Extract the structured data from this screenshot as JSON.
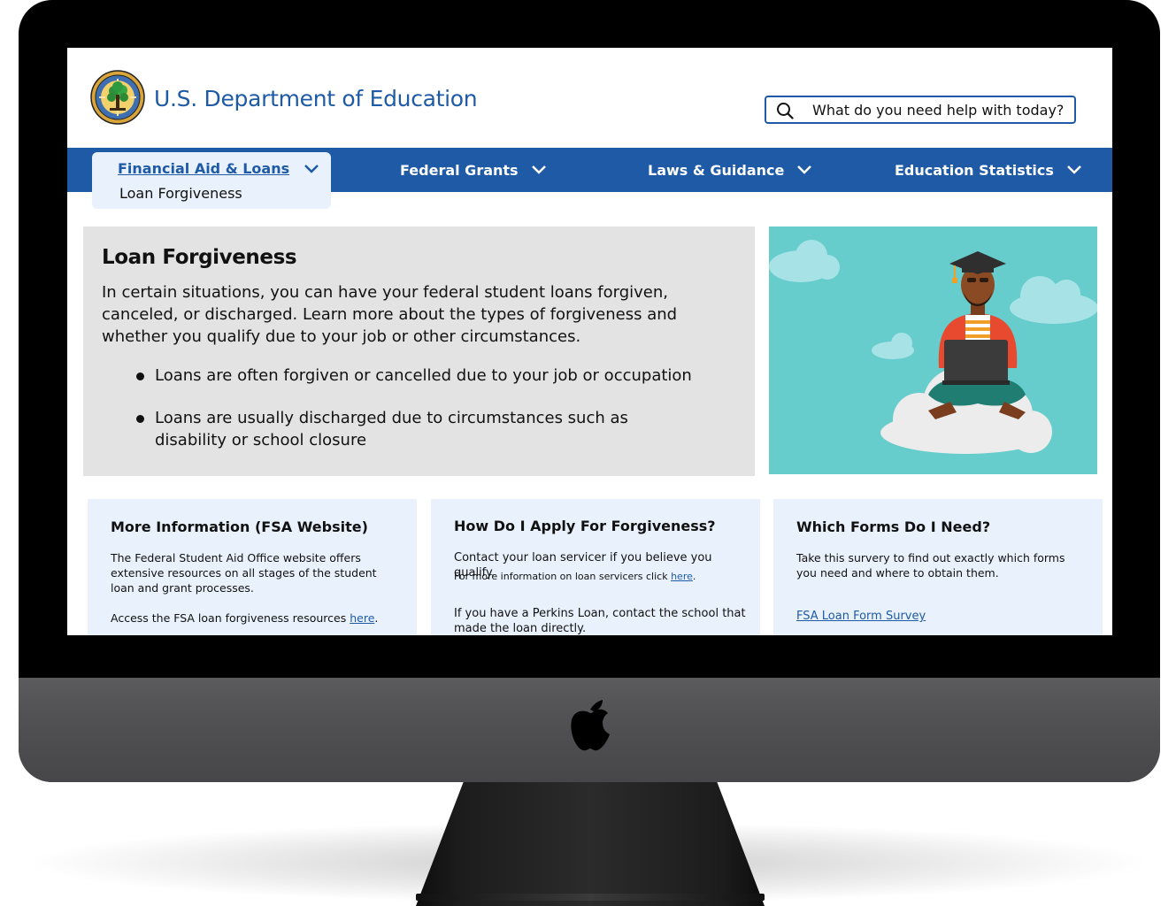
{
  "site": {
    "title": "U.S. Department of Education",
    "brand_color": "#1f5aa6"
  },
  "search": {
    "placeholder": "What do you need help with today?",
    "icon": "search-icon"
  },
  "nav": {
    "items": [
      {
        "label": "Financial Aid & Loans",
        "active": true
      },
      {
        "label": "Federal Grants"
      },
      {
        "label": "Laws & Guidance"
      },
      {
        "label": "Education Statistics"
      }
    ],
    "submenu": {
      "label": "Loan Forgiveness"
    }
  },
  "hero": {
    "title": "Loan Forgiveness",
    "intro": "In certain situations, you can have your federal student loans forgiven, canceled, or discharged.  Learn more  about the types of forgiveness and whether you qualify due to your job or other circumstances.",
    "bullets": [
      "Loans are often forgiven or cancelled due to your job or occupation",
      "Loans are usually discharged due to circumstances such as disability or school closure"
    ],
    "background": "#e3e3e3"
  },
  "cards": [
    {
      "title": "More Information (FSA Website)",
      "body": "The Federal Student Aid Office website offers extensive resources on all stages of the student loan and grant processes.",
      "link_prefix": "Access the FSA loan forgiveness resources ",
      "link_text": "here",
      "link_suffix": "."
    },
    {
      "title": "How Do I Apply For Forgiveness?",
      "body": "Contact your loan servicer if you believe you qualify.",
      "small_prefix": "For more information on loan servicers click ",
      "small_link": "here",
      "small_suffix": ".",
      "body2": "If you have a Perkins Loan, contact the school that made the loan directly."
    },
    {
      "title": "Which Forms Do I Need?",
      "body": "Take this survery to find out exactly which forms you need and where to obtain them.",
      "link_text": "FSA Loan Form Survey"
    }
  ],
  "colors": {
    "card_bg": "#e9f2fc",
    "illustration_bg": "#66cccc"
  }
}
